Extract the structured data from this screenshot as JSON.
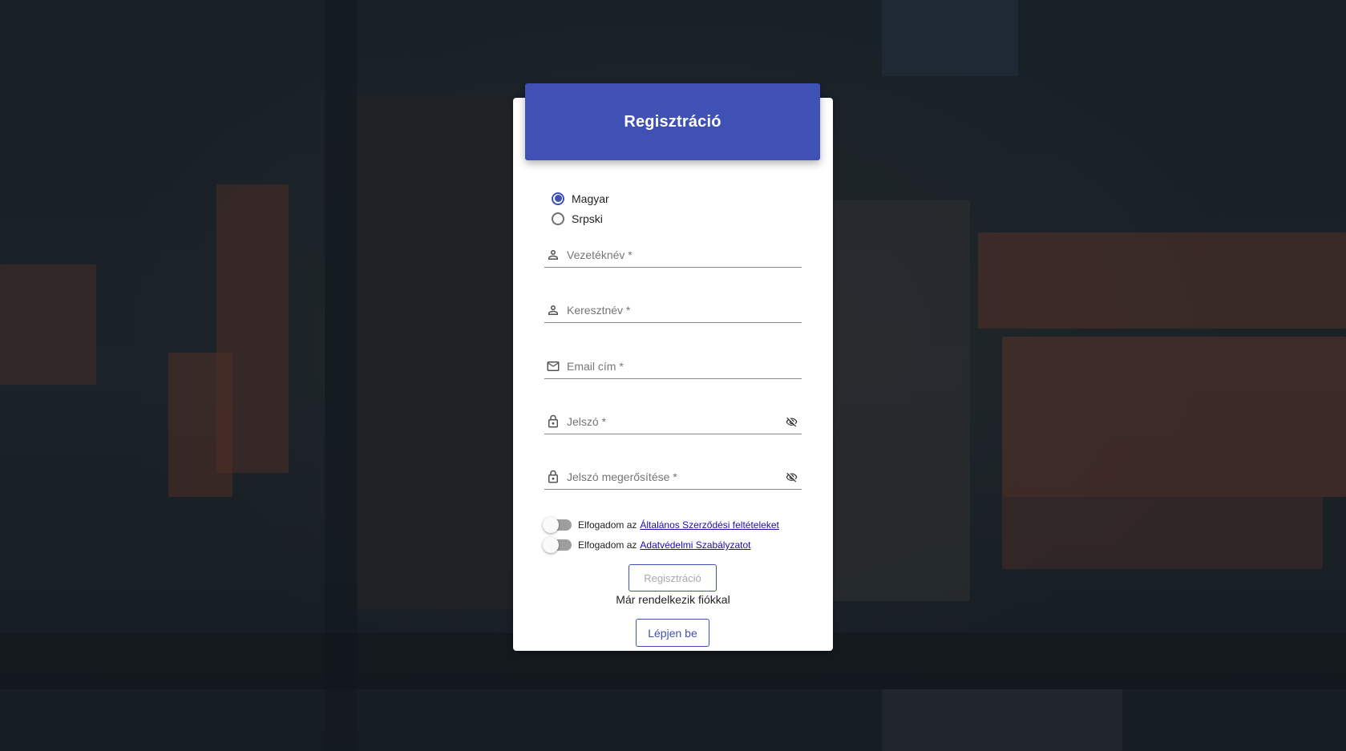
{
  "header": {
    "title": "Regisztráció"
  },
  "language": {
    "options": [
      {
        "label": "Magyar",
        "checked": true
      },
      {
        "label": "Srpski",
        "checked": false
      }
    ]
  },
  "fields": {
    "last_name": {
      "placeholder": "Vezetéknév *",
      "value": "",
      "icon": "person-icon"
    },
    "first_name": {
      "placeholder": "Keresztnév *",
      "value": "",
      "icon": "person-icon"
    },
    "email": {
      "placeholder": "Email cím *",
      "value": "",
      "icon": "mail-icon"
    },
    "password": {
      "placeholder": "Jelszó *",
      "value": "",
      "icon": "lock-icon",
      "toggle_icon": "eye-off-icon"
    },
    "password_confirm": {
      "placeholder": "Jelszó megerősítése *",
      "value": "",
      "icon": "lock-icon",
      "toggle_icon": "eye-off-icon"
    }
  },
  "toggles": {
    "terms": {
      "prefix": "Elfogadom az",
      "link": "Általános Szerződési feltételeket",
      "on": false
    },
    "privacy": {
      "prefix": "Elfogadom az",
      "link": "Adatvédelmi Szabályzatot",
      "on": false
    }
  },
  "actions": {
    "register_label": "Regisztráció",
    "have_account": "Már rendelkezik fiókkal",
    "login_label": "Lépjen be"
  },
  "colors": {
    "primary": "#3f51b5",
    "link": "#1a0dab",
    "toggle_off": "#9e9e9e"
  }
}
